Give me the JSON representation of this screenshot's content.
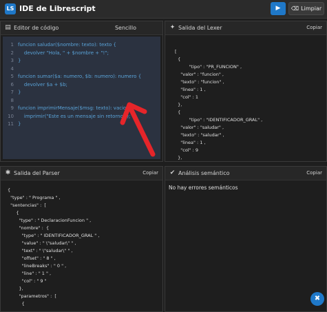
{
  "app": {
    "logo": "LS",
    "title": "IDE de Librescript",
    "run_icon": "play-icon",
    "run_glyph": "▶",
    "clear_label": "Limpiar",
    "clear_glyph": "⌫"
  },
  "editor": {
    "title": "Editor de código",
    "mode_label": "Sencillo",
    "lines": [
      {
        "n": "1",
        "text": "funcion saludar($nombre: texto): texto {"
      },
      {
        "n": "2",
        "text": "    devolver \"Hola, \" + $nombre + \"!\";"
      },
      {
        "n": "3",
        "text": "}"
      },
      {
        "n": "4",
        "text": ""
      },
      {
        "n": "5",
        "text": "funcion sumar($a: numero, $b: numero): numero {"
      },
      {
        "n": "6",
        "text": "    devolver $a + $b;"
      },
      {
        "n": "7",
        "text": "}"
      },
      {
        "n": "8",
        "text": ""
      },
      {
        "n": "9",
        "text": "funcion imprimirMensaje($msg: texto): vacio {"
      },
      {
        "n": "10",
        "text": "    imprimir(\"Este es un mensaje sin retorno.\");"
      },
      {
        "n": "11",
        "text": "}"
      }
    ]
  },
  "lexer": {
    "title": "Salida del Lexer",
    "copy_label": "Copiar",
    "lines": [
      "[",
      "  {",
      "          \"tipo\" : \"PR_FUNCION\" ,",
      "    \"valor\" : \"funcion\" ,",
      "    \"texto\" : \"funcion\" ,",
      "    \"linea\" : 1 ,",
      "    \"col\" : 1",
      "  },",
      "  {",
      "          \"tipo\" : \"IDENTIFICADOR_GRAL\" ,",
      "    \"valor\" : \"saludar\" ,",
      "    \"texto\" : \"saludar\" ,",
      "    \"linea\" : 1 ,",
      "    \"col\" : 9",
      "  },"
    ]
  },
  "parser": {
    "title": "Salida del Parser",
    "copy_label": "Copiar",
    "lines": [
      "{",
      "  \"type\" : \" Programa \" ,",
      "  \"sentencias\" :  [",
      "      {",
      "        \"type\" : \" DeclaracionFuncion \" ,",
      "        \"nombre\" :  {",
      "          \"type\" : \" IDENTIFICADOR_GRAL \" ,",
      "          \"value\" : \" \\\"saludar\\\" \" ,",
      "          \"text\" : \" \\\"saludar\\\" \" ,",
      "          \"offset\" : \" 8 \" ,",
      "          \"lineBreaks\" : \" 0 \" ,",
      "          \"line\" : \" 1 \" ,",
      "          \"col\" : \" 9 \"",
      "        },",
      "        \"parametros\" :  [",
      "          {"
    ]
  },
  "semantic": {
    "title": "Análisis semántico",
    "copy_label": "Copiar",
    "message": "No hay errores semánticos"
  },
  "colors": {
    "accent": "#1f78c8",
    "arrow": "#e5252a",
    "code_text": "#5aa3d8",
    "editor_bg": "#2b3240"
  }
}
